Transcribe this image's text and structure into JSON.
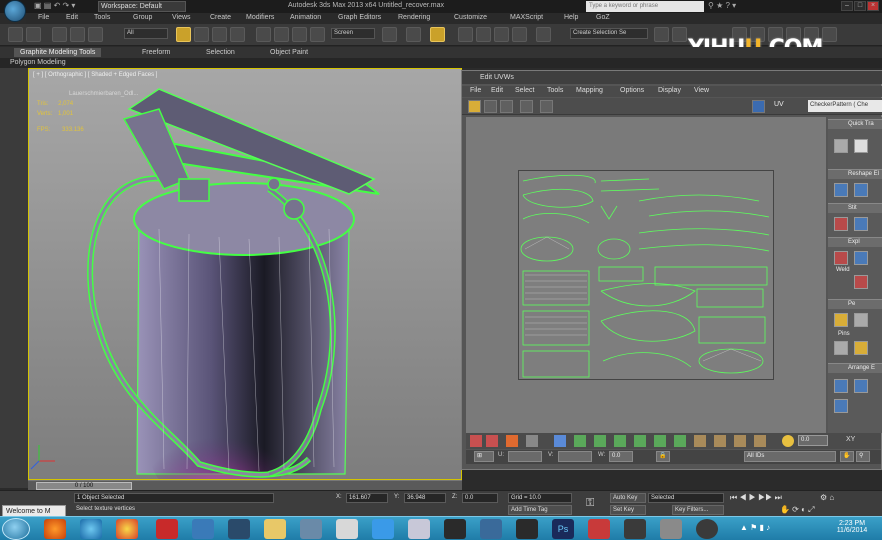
{
  "titlebar": {
    "workspace": "Workspace: Default",
    "title": "Autodesk 3ds Max 2013 x64    Untitled_recover.max",
    "search_placeholder": "Type a keyword or phrase"
  },
  "menu": [
    "File",
    "Edit",
    "Tools",
    "Group",
    "Views",
    "Create",
    "Modifiers",
    "Animation",
    "Graph Editors",
    "Rendering",
    "Customize",
    "MAXScript",
    "Help",
    "GoZ"
  ],
  "toolbar": {
    "filter_all": "All",
    "ref_coord": "Screen",
    "selection_set": "Create Selection Se"
  },
  "ribbon": {
    "tabs": [
      "Graphite Modeling Tools",
      "Freeform",
      "Selection",
      "Object Paint"
    ],
    "sub": "Polygon Modeling"
  },
  "watermark": {
    "prefix": "YIHU",
    "u": "U",
    "suffix": ".COM"
  },
  "viewport": {
    "label": "[ + ] [ Orthographic ] [ Shaded + Edged Faces ]",
    "object_name": "Lauerschmierbaren_Odl...",
    "stats": [
      {
        "label": "Tris:",
        "value": "2,074"
      },
      {
        "label": "Verts:",
        "value": "1,001"
      },
      {
        "label": "FPS:",
        "value": "333.136"
      }
    ]
  },
  "uv_editor": {
    "title": "Edit UVWs",
    "menu": [
      "File",
      "Edit",
      "Select",
      "Tools",
      "Mapping",
      "Options",
      "Display",
      "View"
    ],
    "uv_label": "UV",
    "texture": "CheckerPattern  ( Che",
    "side_panels": [
      "Quick Tra",
      "Reshape El",
      "Stit",
      "Expl",
      "Pe",
      "Arrange E"
    ],
    "weld_label": "Weld",
    "pins_label": "Pins",
    "footer": {
      "u_value": "",
      "v_value": "",
      "w_value": "0.0",
      "id_filter": "All IDs",
      "spinner": "0.0"
    }
  },
  "timeline": {
    "frame": "0 / 100"
  },
  "status": {
    "selected": "1 Object Selected",
    "prompt": "Select texture vertices",
    "x_label": "X:",
    "x_value": "161.607",
    "y_label": "Y:",
    "y_value": "36.948",
    "z_label": "Z:",
    "z_value": "0.0",
    "grid": "Grid = 10.0",
    "add_time_tag": "Add Time Tag",
    "auto_key": "Auto Key",
    "set_key": "Set Key",
    "selected_dd": "Selected",
    "key_filters": "Key Filters...",
    "welcome": "Welcome to M"
  },
  "taskbar": {
    "time": "2:23 PM",
    "date": "11/6/2014"
  },
  "colors": {
    "wire_green": "#33ff33",
    "selection_yellow": "#d4c400",
    "taskbar_blue": "#2a8fbc"
  }
}
